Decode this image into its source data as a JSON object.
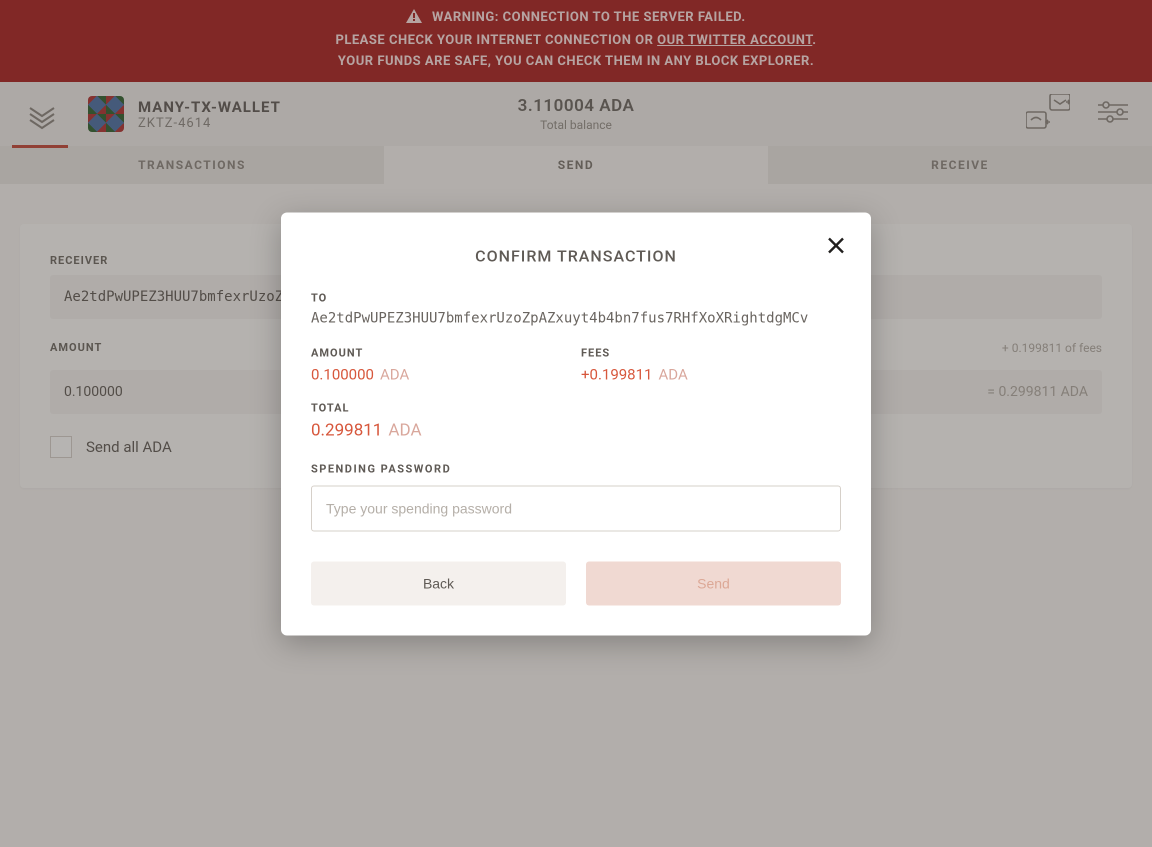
{
  "warning": {
    "line1": "WARNING: CONNECTION TO THE SERVER FAILED.",
    "line2_pre": "PLEASE CHECK YOUR INTERNET CONNECTION OR ",
    "line2_link": "OUR TWITTER ACCOUNT",
    "line2_post": ".",
    "line3": "YOUR FUNDS ARE SAFE, YOU CAN CHECK THEM IN ANY BLOCK EXPLORER."
  },
  "wallet": {
    "name": "MANY-TX-WALLET",
    "sub": "ZKTZ-4614",
    "balance": "3.110004 ADA",
    "balance_label": "Total balance"
  },
  "tabs": {
    "transactions": "TRANSACTIONS",
    "send": "SEND",
    "receive": "RECEIVE"
  },
  "form": {
    "receiver_label": "RECEIVER",
    "receiver_value": "Ae2tdPwUPEZ3HUU7bmfexrUzoZpAZxuyt4b4bn7fus7RHfXoXRightdgMCv",
    "amount_label": "AMOUNT",
    "amount_value": "0.100000",
    "fees_note": "+ 0.199811 of fees",
    "amount_eq": "= 0.299811 ADA",
    "sendall_label": "Send all ADA"
  },
  "modal": {
    "title": "CONFIRM TRANSACTION",
    "to_label": "TO",
    "to_value": "Ae2tdPwUPEZ3HUU7bmfexrUzoZpAZxuyt4b4bn7fus7RHfXoXRightdgMCv",
    "amount_label": "AMOUNT",
    "amount_value": "0.100000",
    "amount_currency": "ADA",
    "fees_label": "FEES",
    "fees_value": "+0.199811",
    "fees_currency": "ADA",
    "total_label": "TOTAL",
    "total_value": "0.299811",
    "total_currency": "ADA",
    "spend_label": "SPENDING PASSWORD",
    "spend_placeholder": "Type your spending password",
    "back": "Back",
    "send": "Send"
  }
}
